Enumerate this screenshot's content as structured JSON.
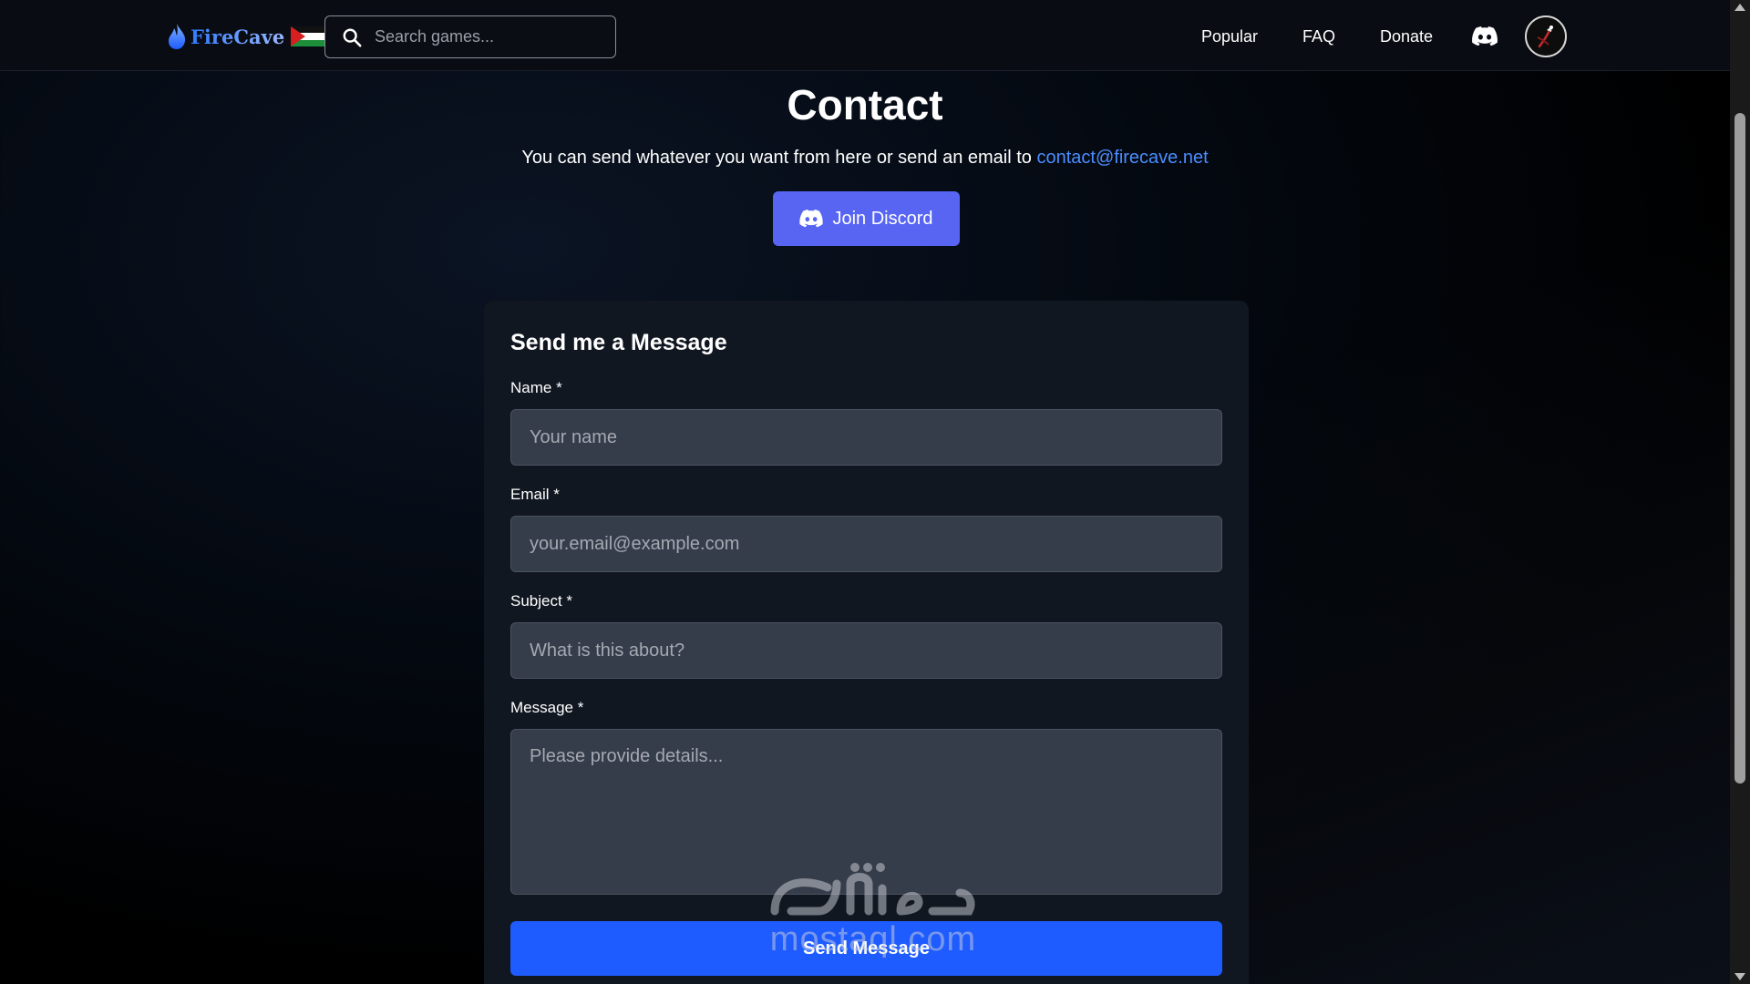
{
  "header": {
    "logo_text": "FireCave",
    "search_placeholder": "Search games...",
    "nav": [
      {
        "label": "Popular"
      },
      {
        "label": "FAQ"
      },
      {
        "label": "Donate"
      }
    ],
    "icons": [
      "flame-icon",
      "palestine-flag-icon",
      "search-icon",
      "discord-icon",
      "avatar"
    ]
  },
  "contact": {
    "title": "Contact",
    "subtitle_text": "You can send whatever you want from here or send an email to ",
    "email": "contact@firecave.net",
    "discord_button": "Join Discord"
  },
  "form": {
    "title": "Send me a Message",
    "name_label": "Name *",
    "name_placeholder": "Your name",
    "email_label": "Email *",
    "email_placeholder": "your.email@example.com",
    "subject_label": "Subject *",
    "subject_placeholder": "What is this about?",
    "message_label": "Message *",
    "message_placeholder": "Please provide details...",
    "submit_label": "Send Message"
  },
  "watermark": {
    "arabic": "مستقل",
    "latin": "mostaql.com"
  },
  "colors": {
    "accent_discord": "#5865f2",
    "accent_submit": "#1e5cff",
    "link": "#4b8dff",
    "card_bg": "#111721",
    "field_bg": "#363d4a"
  }
}
